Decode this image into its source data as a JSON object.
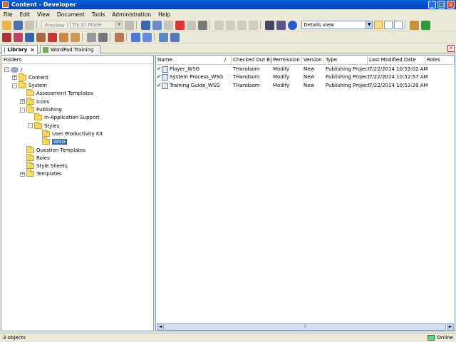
{
  "window": {
    "title": "Content - Developer"
  },
  "menu": [
    "File",
    "Edit",
    "View",
    "Document",
    "Tools",
    "Administration",
    "Help"
  ],
  "toolbar": {
    "preview_label": "Preview",
    "mode_combo_value": "Try It! Mode",
    "view_combo_value": "Details view"
  },
  "tabs": [
    {
      "label": "Library",
      "active": true
    },
    {
      "label": "WordPad Training",
      "active": false
    }
  ],
  "folders": {
    "header": "Folders",
    "items": [
      {
        "label": "/",
        "level": 0,
        "expander": "-"
      },
      {
        "label": "Content",
        "level": 1,
        "expander": "+"
      },
      {
        "label": "System",
        "level": 1,
        "expander": "-"
      },
      {
        "label": "Assessment Templates",
        "level": 2,
        "expander": ""
      },
      {
        "label": "Icons",
        "level": 2,
        "expander": "+"
      },
      {
        "label": "Publishing",
        "level": 2,
        "expander": "-"
      },
      {
        "label": "In-Application Support",
        "level": 3,
        "expander": ""
      },
      {
        "label": "Styles",
        "level": 3,
        "expander": "-"
      },
      {
        "label": "User Productivity Kit",
        "level": 4,
        "expander": ""
      },
      {
        "label": "WSG",
        "level": 4,
        "expander": "",
        "selected": true
      },
      {
        "label": "Question Templates",
        "level": 2,
        "expander": ""
      },
      {
        "label": "Roles",
        "level": 2,
        "expander": ""
      },
      {
        "label": "Style Sheets",
        "level": 2,
        "expander": ""
      },
      {
        "label": "Templates",
        "level": 2,
        "expander": "+"
      }
    ]
  },
  "documents": {
    "columns": [
      "Name",
      "Checked Out By",
      "Permission",
      "Version",
      "Type",
      "Last Modified Date",
      "Roles"
    ],
    "sort_indicator": "/",
    "rows": [
      {
        "name": "Player_WSG",
        "checked_out_by": "THandsom",
        "permission": "Modify",
        "version": "New",
        "type": "Publishing Project",
        "modified": "7/22/2014 10:53:02 AM",
        "roles": ""
      },
      {
        "name": "System Process_WSG",
        "checked_out_by": "THandsom",
        "permission": "Modify",
        "version": "New",
        "type": "Publishing Project",
        "modified": "7/22/2014 10:52:57 AM",
        "roles": ""
      },
      {
        "name": "Training Guide_WSG",
        "checked_out_by": "THandsom",
        "permission": "Modify",
        "version": "New",
        "type": "Publishing Project",
        "modified": "7/22/2014 10:53:39 AM",
        "roles": ""
      }
    ]
  },
  "status": {
    "count": "3 objects",
    "connection": "Online"
  },
  "colors": {
    "titlebar": "#0a5fd8",
    "selection": "#316ac5",
    "check": "#1a8a1a",
    "folder": "#f5d86c"
  }
}
